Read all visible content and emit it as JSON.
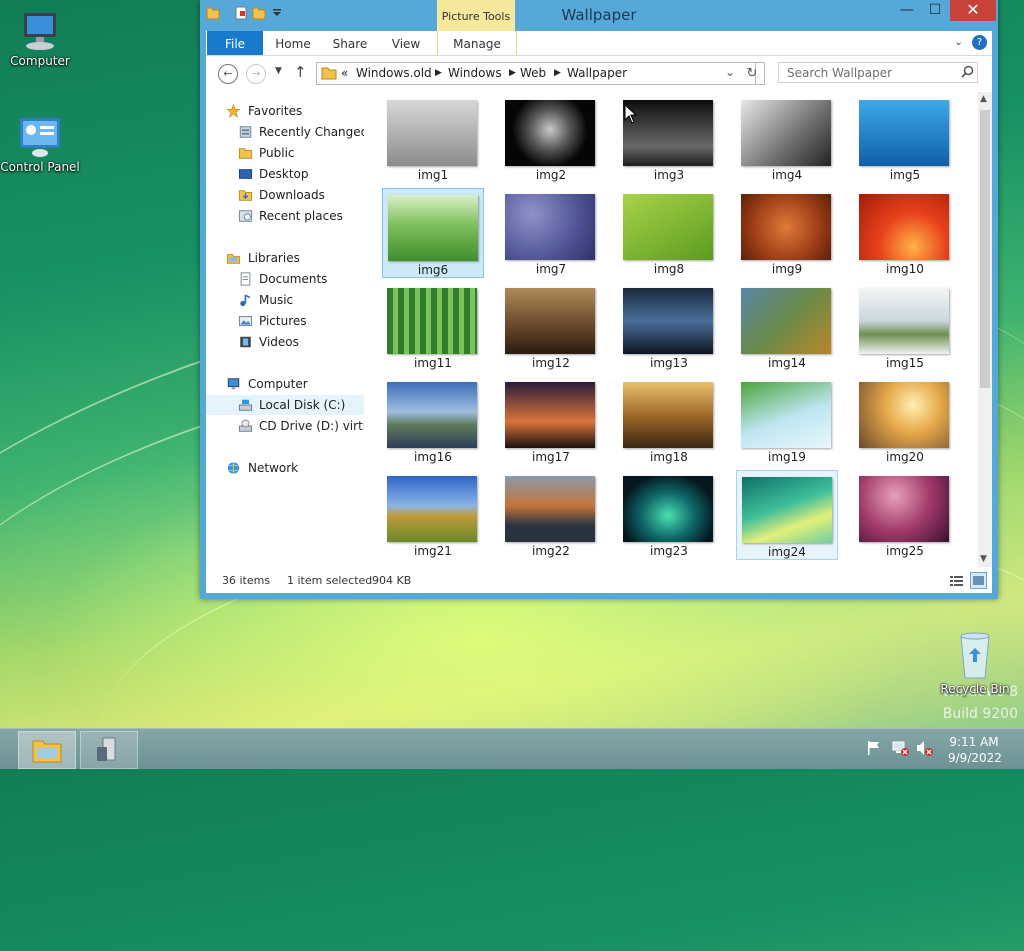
{
  "desktop": {
    "icons": [
      {
        "label": "Computer"
      },
      {
        "label": "Control Panel"
      },
      {
        "label": "Recycle Bin"
      }
    ],
    "watermark": {
      "line1": "Windows 8",
      "line2": "Build 9200"
    }
  },
  "window": {
    "title": "Wallpaper",
    "contextual_tab_group": "Picture Tools",
    "ribbon_tabs": [
      "File",
      "Home",
      "Share",
      "View",
      "Manage"
    ],
    "controls": {
      "minimize": "—",
      "maximize": "☐",
      "close": "✕"
    }
  },
  "address": {
    "overflow": "«",
    "crumbs": [
      "Windows.old",
      "Windows",
      "Web",
      "Wallpaper"
    ],
    "search_placeholder": "Search Wallpaper"
  },
  "nav": {
    "favorites": {
      "label": "Favorites",
      "items": [
        "Recently Changed",
        "Public",
        "Desktop",
        "Downloads",
        "Recent places"
      ]
    },
    "libraries": {
      "label": "Libraries",
      "items": [
        "Documents",
        "Music",
        "Pictures",
        "Videos"
      ]
    },
    "computer": {
      "label": "Computer",
      "items": [
        "Local Disk (C:)",
        "CD Drive (D:) virtio-w"
      ]
    },
    "network": {
      "label": "Network"
    }
  },
  "files": [
    {
      "name": "img1"
    },
    {
      "name": "img2"
    },
    {
      "name": "img3"
    },
    {
      "name": "img4"
    },
    {
      "name": "img5"
    },
    {
      "name": "img6"
    },
    {
      "name": "img7"
    },
    {
      "name": "img8"
    },
    {
      "name": "img9"
    },
    {
      "name": "img10"
    },
    {
      "name": "img11"
    },
    {
      "name": "img12"
    },
    {
      "name": "img13"
    },
    {
      "name": "img14"
    },
    {
      "name": "img15"
    },
    {
      "name": "img16"
    },
    {
      "name": "img17"
    },
    {
      "name": "img18"
    },
    {
      "name": "img19"
    },
    {
      "name": "img20"
    },
    {
      "name": "img21"
    },
    {
      "name": "img22"
    },
    {
      "name": "img23"
    },
    {
      "name": "img24"
    },
    {
      "name": "img25"
    }
  ],
  "status": {
    "item_count": "36 items",
    "selection": "1 item selected",
    "size": "904 KB"
  },
  "taskbar": {
    "time": "9:11 AM",
    "date": "9/9/2022"
  }
}
